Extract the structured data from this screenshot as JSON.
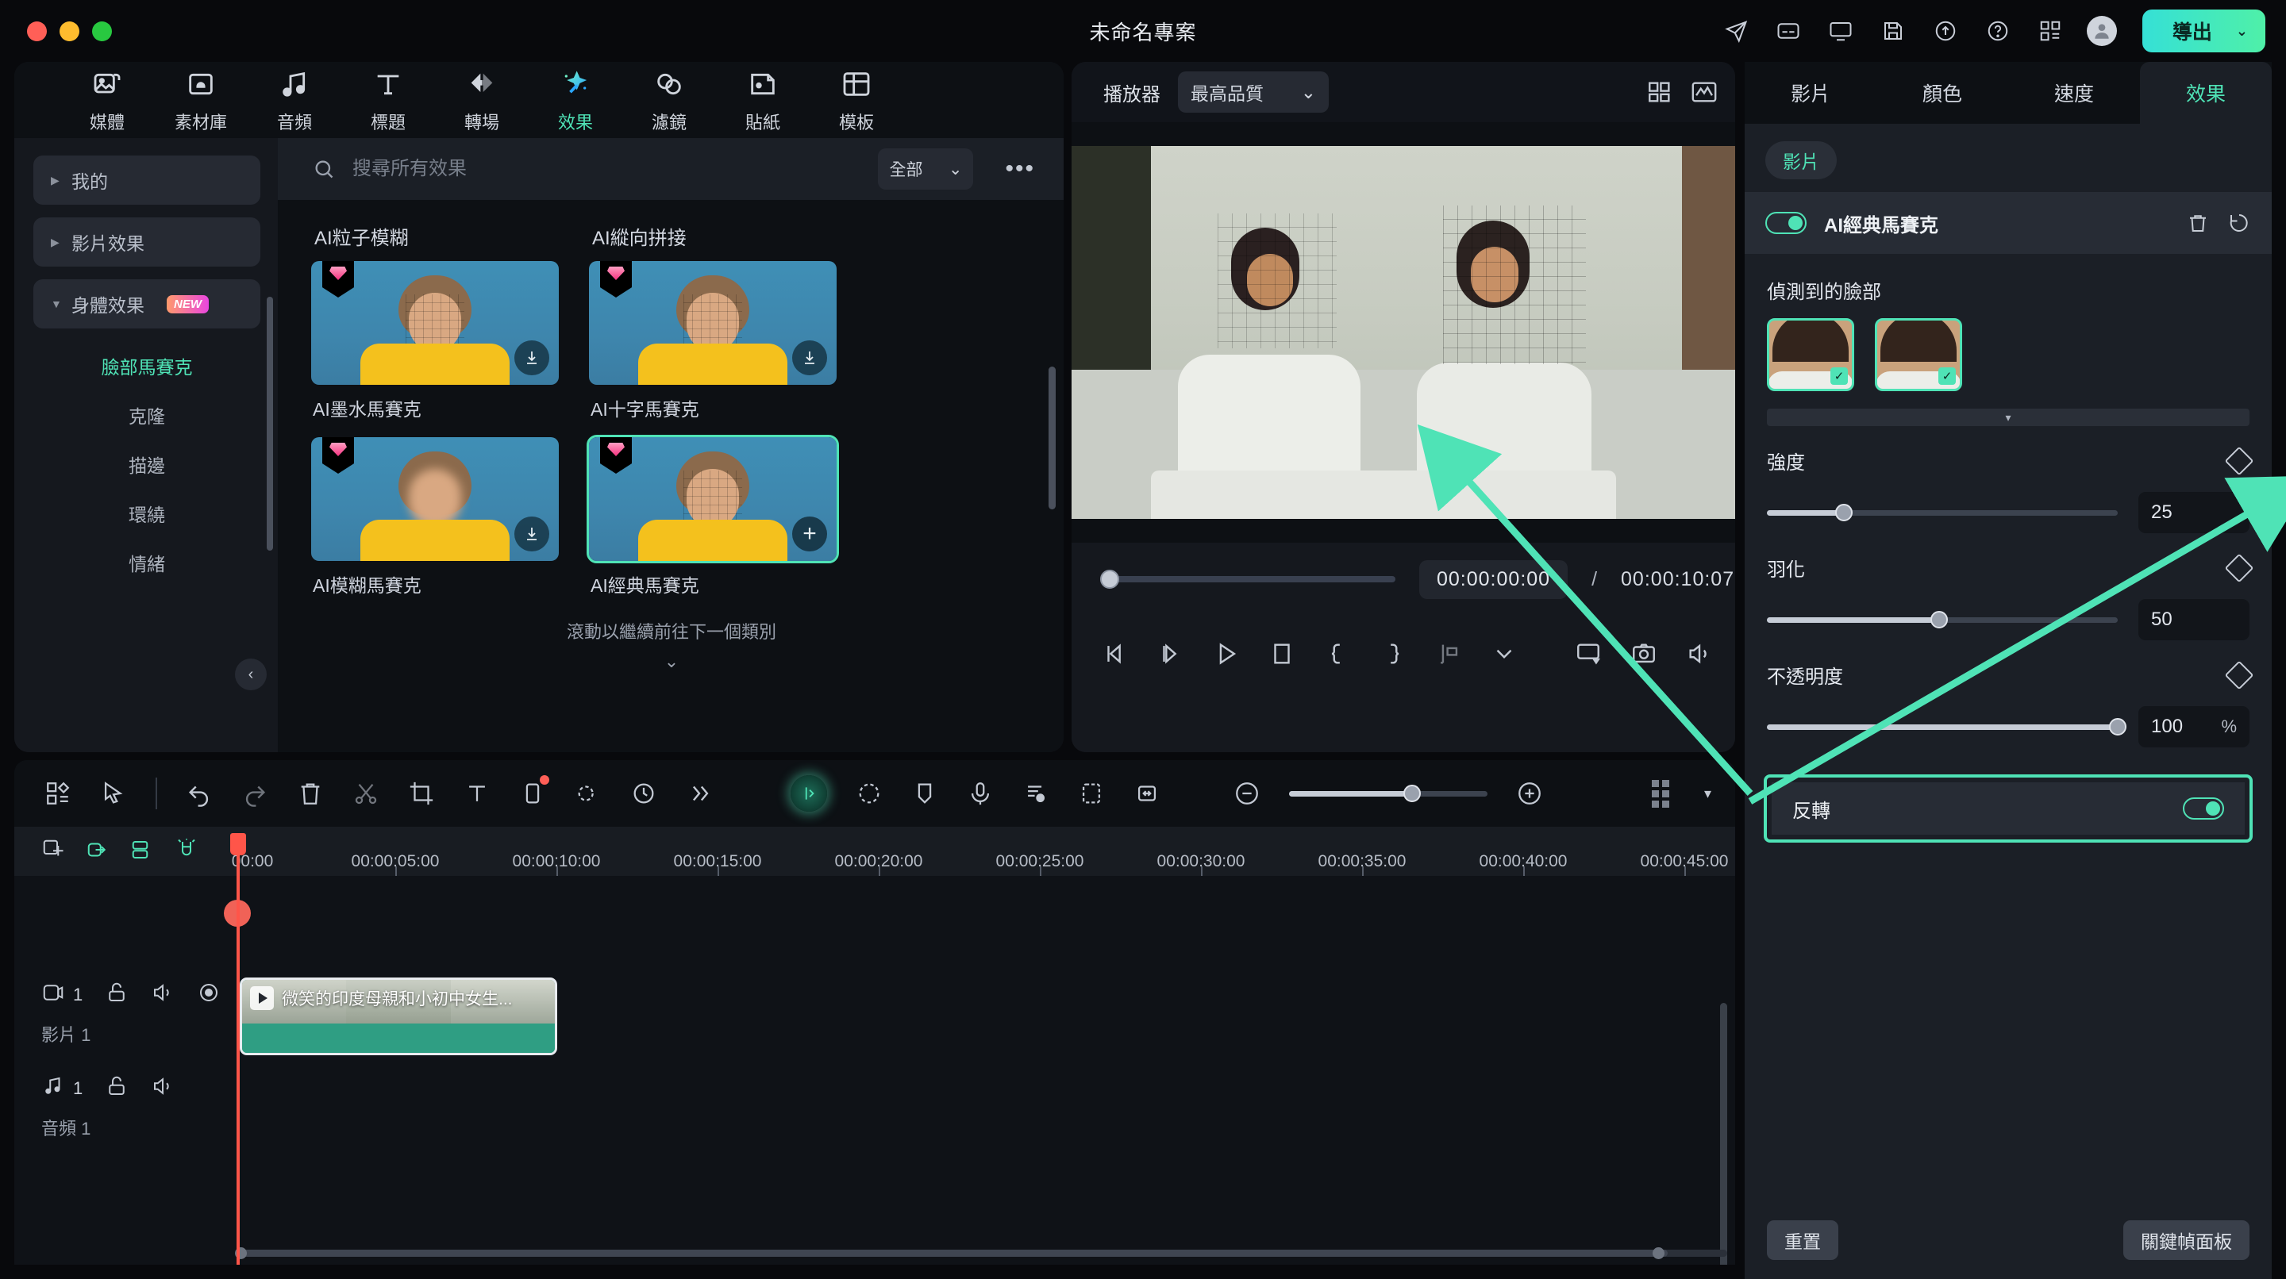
{
  "titlebar": {
    "project_title": "未命名專案",
    "export_label": "導出",
    "export_chevron": "⌄",
    "icons": [
      "share-icon",
      "subtitle-icon",
      "screen-icon",
      "save-icon",
      "cloud-upload-icon",
      "help-icon",
      "apps-grid-icon"
    ]
  },
  "library": {
    "tabs": [
      {
        "label": "媒體",
        "icon": "media-icon",
        "active": false
      },
      {
        "label": "素材庫",
        "icon": "stock-icon",
        "active": false
      },
      {
        "label": "音頻",
        "icon": "audio-icon",
        "active": false
      },
      {
        "label": "標題",
        "icon": "title-icon",
        "active": false
      },
      {
        "label": "轉場",
        "icon": "transition-icon",
        "active": false
      },
      {
        "label": "效果",
        "icon": "effects-icon",
        "active": true
      },
      {
        "label": "濾鏡",
        "icon": "filter-icon",
        "active": false
      },
      {
        "label": "貼紙",
        "icon": "sticker-icon",
        "active": false
      },
      {
        "label": "模板",
        "icon": "template-icon",
        "active": false
      }
    ],
    "categories": [
      {
        "label": "我的",
        "expanded": false
      },
      {
        "label": "影片效果",
        "expanded": false
      },
      {
        "label": "身體效果",
        "expanded": true,
        "badge": "NEW"
      }
    ],
    "subcategories": [
      {
        "label": "臉部馬賽克",
        "selected": true
      },
      {
        "label": "克隆",
        "selected": false
      },
      {
        "label": "描邊",
        "selected": false
      },
      {
        "label": "環繞",
        "selected": false
      },
      {
        "label": "情緒",
        "selected": false
      }
    ],
    "search": {
      "placeholder": "搜尋所有效果",
      "value": ""
    },
    "filter": {
      "label": "全部",
      "chevron": "⌄"
    },
    "more_label": "•••",
    "effects": [
      {
        "name": "AI粒子模糊",
        "premium": true,
        "action": "download",
        "selected": false
      },
      {
        "name": "AI縱向拼接",
        "premium": true,
        "action": "download",
        "selected": false
      },
      {
        "name": "AI墨水馬賽克",
        "premium": true,
        "action": "download",
        "selected": false
      },
      {
        "name": "AI十字馬賽克",
        "premium": true,
        "action": "download",
        "selected": false
      },
      {
        "name": "AI模糊馬賽克",
        "premium": true,
        "action": "download",
        "selected": false
      },
      {
        "name": "AI經典馬賽克",
        "premium": true,
        "action": "add",
        "selected": true
      }
    ],
    "scroll_hint": "滾動以繼續前往下一個類別",
    "scroll_chevron": "⌄"
  },
  "preview": {
    "label": "播放器",
    "quality": "最高品質",
    "quality_chevron": "⌄",
    "header_icons": [
      "layout-grid-icon",
      "waveform-icon"
    ],
    "current_time": "00:00:00:00",
    "separator": "/",
    "total_time": "00:00:10:07",
    "buttons": [
      "prev-frame-icon",
      "next-frame-icon",
      "play-icon",
      "stop-icon",
      "mark-in-icon",
      "mark-out-icon",
      "snapshot-marker-icon",
      "chevron-down-icon",
      "display-icon",
      "camera-icon",
      "volume-icon",
      "fullscreen-icon"
    ]
  },
  "properties": {
    "tabs": [
      {
        "label": "影片",
        "active": false
      },
      {
        "label": "顏色",
        "active": false
      },
      {
        "label": "速度",
        "active": false
      },
      {
        "label": "效果",
        "active": true
      }
    ],
    "chip": "影片",
    "effect_row": {
      "name": "AI經典馬賽克",
      "enabled": true,
      "delete_icon": "trash-icon",
      "reset_icon": "reset-icon"
    },
    "faces_label": "偵測到的臉部",
    "faces": [
      {
        "selected": true
      },
      {
        "selected": true
      }
    ],
    "expander_chevron": "▾",
    "sliders": [
      {
        "label": "強度",
        "value": "25",
        "unit": "",
        "percent": 22,
        "keyframe_icon": "diamond-icon"
      },
      {
        "label": "羽化",
        "value": "50",
        "unit": "",
        "percent": 49,
        "keyframe_icon": "diamond-icon"
      },
      {
        "label": "不透明度",
        "value": "100",
        "unit": "%",
        "percent": 100,
        "keyframe_icon": "diamond-icon"
      }
    ],
    "invert": {
      "label": "反轉",
      "enabled": true
    },
    "reset_label": "重置",
    "keyframe_panel_label": "關鍵幀面板"
  },
  "timeline": {
    "toolbar_icons": [
      "templates-icon",
      "select-tool-icon",
      "divider",
      "undo-icon",
      "redo-icon",
      "delete-icon",
      "split-icon",
      "crop-icon",
      "text-icon",
      "mask-icon",
      "keyframe-icon",
      "speed-icon",
      "more-icon"
    ],
    "toolbar_icons_right": [
      "ai-tools-icon",
      "motion-tracking-icon",
      "marker-icon",
      "voiceover-icon",
      "audio-mix-icon",
      "green-screen-icon",
      "fit-icon"
    ],
    "zoom_out_icon": "minus-icon",
    "zoom_in_icon": "plus-icon",
    "zoom_percent": 62,
    "grid_icon": "grid-icon",
    "grid_chevron": "▾",
    "track_head_icons": [
      "add-track-icon",
      "link-icon",
      "group-icon",
      "magnet-icon"
    ],
    "ruler_ticks": [
      "00:00",
      "00:00:05:00",
      "00:00:10:00",
      "00:00:15:00",
      "00:00:20:00",
      "00:00:25:00",
      "00:00:30:00",
      "00:00:35:00",
      "00:00:40:00",
      "00:00:45:00"
    ],
    "tracks": [
      {
        "type": "video",
        "count": "1",
        "name": "影片 1",
        "icons": [
          "video-track-icon",
          "unlock-icon",
          "speaker-icon",
          "eye-icon"
        ],
        "clip": {
          "label": "微笑的印度母親和小初中女生...",
          "selected": true
        }
      },
      {
        "type": "audio",
        "count": "1",
        "name": "音頻 1",
        "icons": [
          "audio-track-icon",
          "unlock-icon",
          "speaker-icon"
        ],
        "clip": null
      }
    ]
  },
  "colors": {
    "accent": "#4fe3b6",
    "panel_bg": "#1b1f26",
    "dark_bg": "#0d1014",
    "playhead": "#ff5549",
    "clip": "#2f9e83"
  }
}
